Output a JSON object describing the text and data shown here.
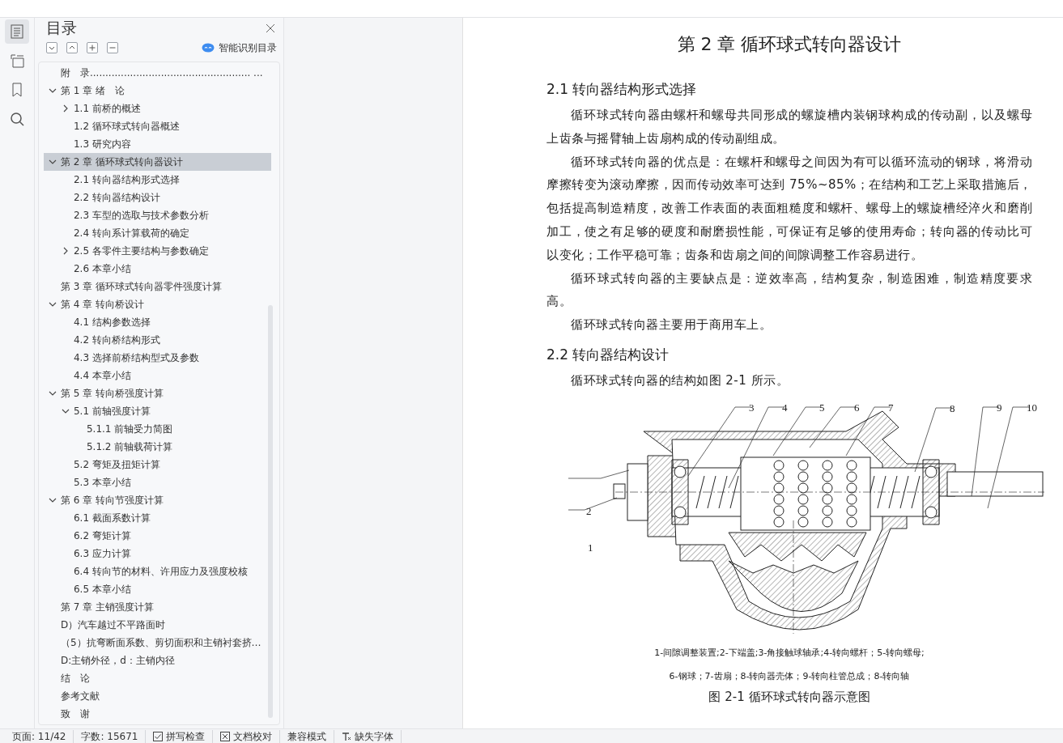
{
  "nav_rail": {
    "items": [
      {
        "kind": "contents",
        "selected": true
      },
      {
        "kind": "outline",
        "selected": false
      },
      {
        "kind": "bookmark",
        "selected": false
      },
      {
        "kind": "search",
        "selected": false
      }
    ]
  },
  "toc_panel": {
    "title": "目录",
    "smart_button": "智能识别目录",
    "tools": [
      {
        "kind": "expand"
      },
      {
        "kind": "collapse"
      },
      {
        "kind": "add"
      },
      {
        "kind": "remove"
      }
    ],
    "items": [
      {
        "label": "附　录.................................................... ...",
        "selected": false
      },
      {
        "label": "第 1 章  绪　论",
        "selected": false,
        "expanded": true,
        "children": [
          {
            "label": "1.1 前桥的概述",
            "selected": false,
            "expanded": false
          },
          {
            "label": "1.2 循环球式转向器概述",
            "selected": false
          },
          {
            "label": "1.3 研究内容",
            "selected": false
          }
        ]
      },
      {
        "label": "第 2 章  循环球式转向器设计",
        "selected": true,
        "expanded": true,
        "children": [
          {
            "label": "2.1 转向器结构形式选择",
            "selected": false
          },
          {
            "label": "2.2 转向器结构设计",
            "selected": false
          },
          {
            "label": "2.3 车型的选取与技术参数分析",
            "selected": false
          },
          {
            "label": "2.4 转向系计算载荷的确定",
            "selected": false
          },
          {
            "label": "2.5 各零件主要结构与参数确定",
            "selected": false,
            "expanded": false
          },
          {
            "label": "2.6 本章小结",
            "selected": false
          }
        ]
      },
      {
        "label": "第 3 章  循环球式转向器零件强度计算",
        "selected": false
      },
      {
        "label": "第 4 章  转向桥设计",
        "selected": false,
        "expanded": true,
        "children": [
          {
            "label": "4.1 结构参数选择",
            "selected": false
          },
          {
            "label": "4.2 转向桥结构形式",
            "selected": false
          },
          {
            "label": "4.3 选择前桥结构型式及参数",
            "selected": false
          },
          {
            "label": "4.4 本章小结",
            "selected": false
          }
        ]
      },
      {
        "label": "第 5 章  转向桥强度计算",
        "selected": false,
        "expanded": true,
        "children": [
          {
            "label": "5.1 前轴强度计算",
            "selected": false,
            "expanded": true,
            "children": [
              {
                "label": "5.1.1 前轴受力简图",
                "selected": false
              },
              {
                "label": "5.1.2 前轴载荷计算",
                "selected": false
              }
            ]
          },
          {
            "label": "5.2 弯矩及扭矩计算",
            "selected": false
          },
          {
            "label": "5.3 本章小结",
            "selected": false
          }
        ]
      },
      {
        "label": "第 6 章  转向节强度计算",
        "selected": false,
        "expanded": true,
        "children": [
          {
            "label": "6.1 截面系数计算",
            "selected": false
          },
          {
            "label": "6.2 弯矩计算",
            "selected": false
          },
          {
            "label": "6.3 应力计算",
            "selected": false
          },
          {
            "label": "6.4 转向节的材料、许用应力及强度校核",
            "selected": false
          },
          {
            "label": "6.5 本章小结",
            "selected": false
          }
        ]
      },
      {
        "label": "第 7 章  主销强度计算",
        "selected": false
      },
      {
        "label": "D）汽车越过不平路面时",
        "selected": false
      },
      {
        "label": "（5）抗弯断面系数、剪切面积和主销衬套挤…",
        "selected": false
      },
      {
        "label": "D:主销外径，d：主销内径",
        "selected": false
      },
      {
        "label": "结　论",
        "selected": false
      },
      {
        "label": "参考文献",
        "selected": false
      },
      {
        "label": "致　谢",
        "selected": false
      }
    ]
  },
  "document": {
    "chapter_title": "第 2 章  循环球式转向器设计",
    "blocks": [
      {
        "kind": "heading",
        "text": "2.1 转向器结构形式选择"
      },
      {
        "kind": "paragraph",
        "text": "循环球式转向器由螺杆和螺母共同形成的螺旋槽内装钢球构成的传动副，以及螺母上齿条与摇臂轴上齿扇构成的传动副组成。"
      },
      {
        "kind": "paragraph",
        "text": "循环球式转向器的优点是：在螺杆和螺母之间因为有可以循环流动的钢球，将滑动摩擦转变为滚动摩擦，因而传动效率可达到 75%~85%；在结构和工艺上采取措施后，包括提高制造精度，改善工作表面的表面粗糙度和螺杆、螺母上的螺旋槽经淬火和磨削加工，使之有足够的硬度和耐磨损性能，可保证有足够的使用寿命；转向器的传动比可以变化；工作平稳可靠；齿条和齿扇之间的间隙调整工作容易进行。"
      },
      {
        "kind": "paragraph",
        "text": "循环球式转向器的主要缺点是：逆效率高，结构复杂，制造困难，制造精度要求高。"
      },
      {
        "kind": "paragraph",
        "text": "循环球式转向器主要用于商用车上。"
      },
      {
        "kind": "heading",
        "text": "2.2 转向器结构设计"
      },
      {
        "kind": "paragraph",
        "text": "循环球式转向器的结构如图 2-1 所示。"
      },
      {
        "kind": "figure",
        "callouts": [
          "3",
          "4",
          "5",
          "6",
          "7",
          "8",
          "9",
          "10",
          "2",
          "1"
        ],
        "legend": [
          "1-间隙调整装置;2-下端盖;3-角接触球轴承;4-转向螺杆；5-转向螺母;",
          "6-钢球；7-齿扇；8-转向器壳体；9-转向柱管总成；8-转向轴"
        ],
        "caption": "图 2-1 循环球式转向器示意图"
      }
    ]
  },
  "status_bar": {
    "items": [
      {
        "kind": "text",
        "label": "页面: 11/42"
      },
      {
        "kind": "text",
        "label": "字数: 15671"
      },
      {
        "kind": "check",
        "label": "拼写检查"
      },
      {
        "kind": "cross",
        "label": "文档校对"
      },
      {
        "kind": "text",
        "label": "兼容模式"
      },
      {
        "kind": "font",
        "label": "缺失字体"
      }
    ]
  }
}
